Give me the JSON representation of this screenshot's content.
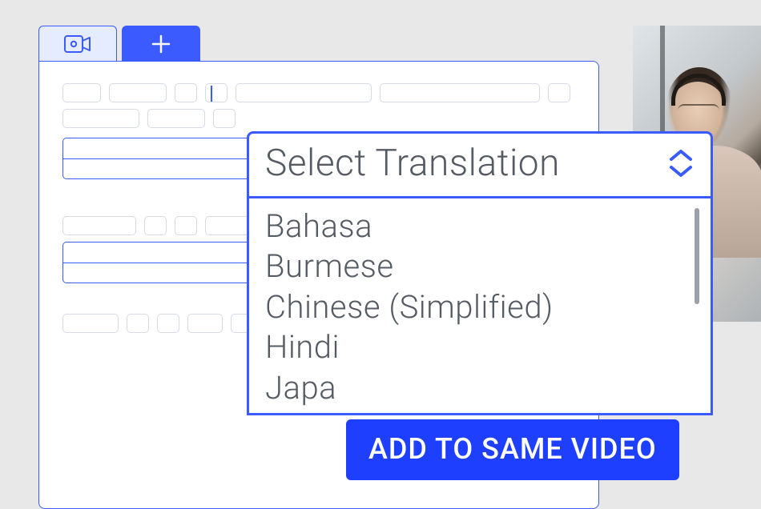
{
  "tabs": {
    "video_icon": "camera-icon",
    "add_icon": "plus-icon"
  },
  "dropdown": {
    "placeholder": "Select Translation",
    "options": [
      "Bahasa",
      "Burmese",
      "Chinese (Simplified)",
      "Hindi",
      "Japa"
    ]
  },
  "cta_label": "ADD TO SAME VIDEO",
  "colors": {
    "primary": "#3b5bff",
    "primary_strong": "#1f3fff",
    "tab_inactive_bg": "#e6ecff",
    "text": "#555b63"
  }
}
